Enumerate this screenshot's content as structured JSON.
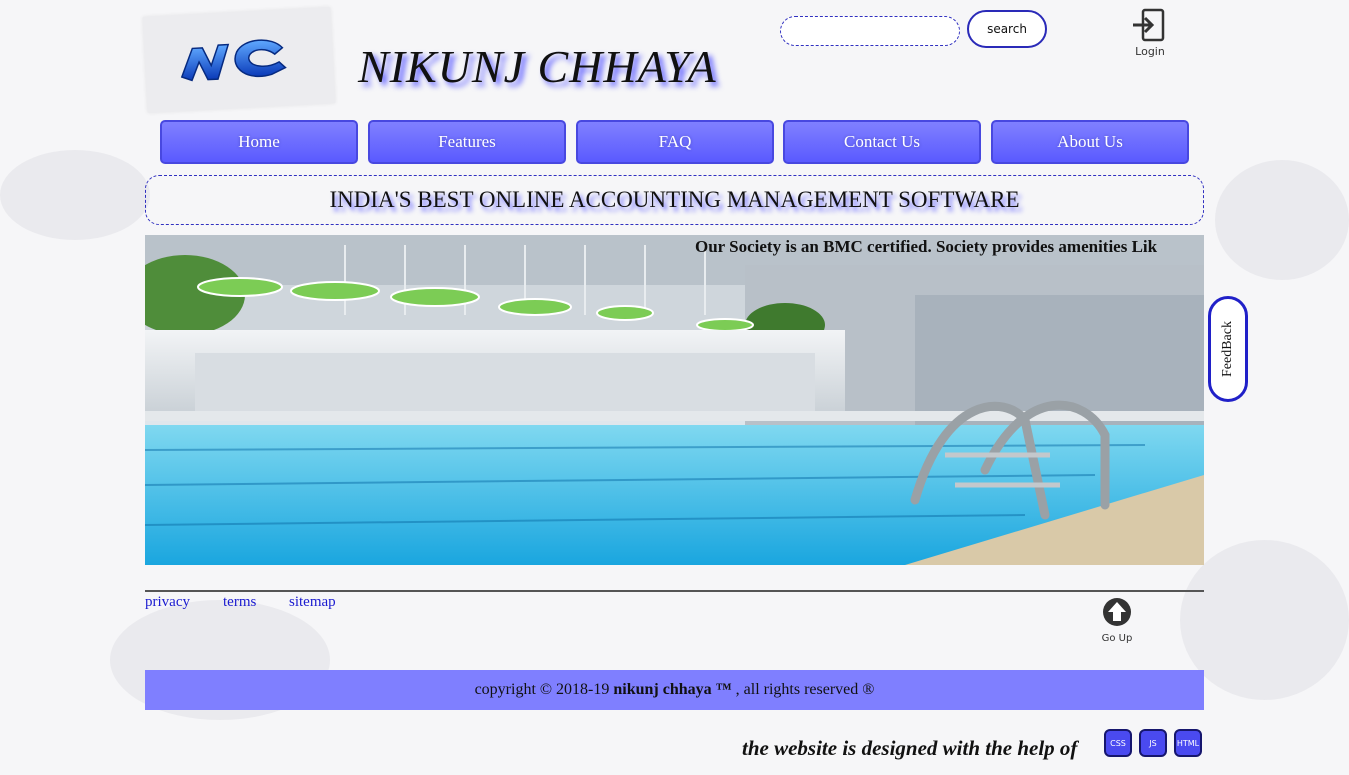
{
  "header": {
    "logo_text": "NC",
    "title": "NIKUNJ CHHAYA",
    "search_placeholder": "",
    "search_button": "search",
    "login_label": "Login"
  },
  "nav": {
    "items": [
      {
        "label": "Home"
      },
      {
        "label": "Features"
      },
      {
        "label": "FAQ"
      },
      {
        "label": "Contact Us"
      },
      {
        "label": "About Us"
      }
    ]
  },
  "banner": "INDIA'S BEST ONLINE ACCOUNTING MANAGEMENT SOFTWARE",
  "marquee": "Our Society is an BMC certified. Society provides amenities Lik",
  "feedback": "FeedBack",
  "footer": {
    "links": [
      {
        "label": "privacy"
      },
      {
        "label": "terms"
      },
      {
        "label": "sitemap"
      }
    ],
    "goup_label": "Go Up"
  },
  "copyright": {
    "prefix": "copyright © 2018-19 ",
    "brand": "nikunj chhaya ™",
    "suffix": " , all rights reserved ®"
  },
  "credit": {
    "text": "the website is designed with the help of",
    "badges": [
      "CSS",
      "JS",
      "HTML"
    ]
  },
  "colors": {
    "nav": "#6a6aff",
    "copyright_bar": "#7f7fff",
    "link": "#1b1bd0",
    "border": "#2020c8"
  }
}
